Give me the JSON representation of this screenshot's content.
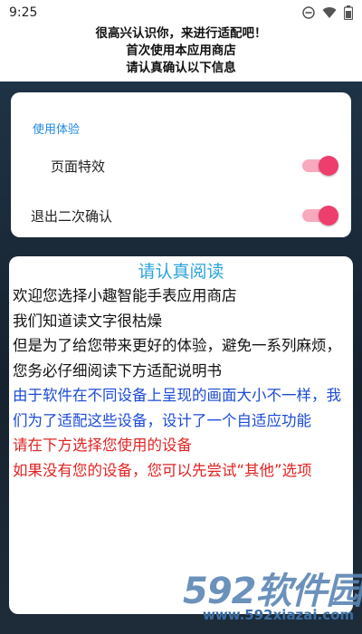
{
  "status_bar": {
    "time": "9:25"
  },
  "header": {
    "line1": "很高兴认识你，来进行适配吧！",
    "line2": "首次使用本应用商店",
    "line3": "请认真确认以下信息"
  },
  "settings": {
    "section_title": "使用体验",
    "items": [
      {
        "label": "页面特效",
        "enabled": true
      },
      {
        "label": "退出二次确认",
        "enabled": true
      }
    ]
  },
  "notice": {
    "title": "请认真阅读",
    "para_black_1": "欢迎您选择小趣智能手表应用商店",
    "para_black_2": "我们知道读文字很枯燥",
    "para_black_3": "但是为了给您带来更好的体验，避免一系列麻烦，您务必仔细阅读下方适配说明书",
    "para_blue": "由于软件在不同设备上呈现的画面大小不一样，我们为了适配这些设备，设计了一个自适应功能",
    "para_red_1": "请在下方选择您使用的设备",
    "para_red_2": "如果没有您的设备，您可以先尝试“其他”选项"
  },
  "watermark": {
    "brand": "592软件园",
    "url": "www.592xiazai.com"
  },
  "colors": {
    "accent_blue": "#1e88e5",
    "toggle_on": "#ee3e6e",
    "text_blue": "#1c4bd6",
    "text_red": "#e02424"
  }
}
